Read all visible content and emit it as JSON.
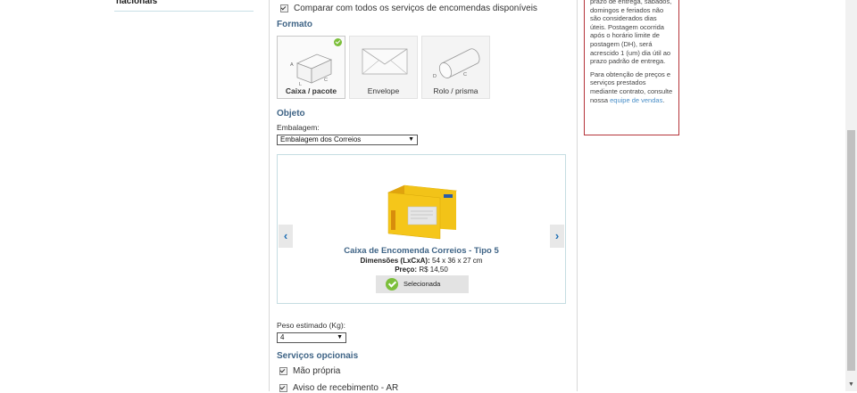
{
  "sidebar": {
    "partial_link": "nacionais"
  },
  "form": {
    "compare_label": "Comparar com todos os serviços de encomendas disponíveis",
    "formato": {
      "title": "Formato",
      "options": [
        {
          "label": "Caixa / pacote",
          "selected": true,
          "icon": "box-icon",
          "dims": [
            "A",
            "L",
            "C"
          ]
        },
        {
          "label": "Envelope",
          "selected": false,
          "icon": "envelope-icon"
        },
        {
          "label": "Rolo / prisma",
          "selected": false,
          "icon": "cylinder-icon",
          "dims": [
            "D",
            "C"
          ]
        }
      ]
    },
    "objeto": {
      "title": "Objeto",
      "embalagem_label": "Embalagem:",
      "embalagem_value": "Embalagem dos Correios"
    },
    "product": {
      "name": "Caixa de Encomenda Correios - Tipo 5",
      "dims_label": "Dimensões (LxCxA):",
      "dims_value": "54 x 36 x 27 cm",
      "price_label": "Preço:",
      "price_value": "R$ 14,50",
      "selected_label": "Selecionada",
      "prev": "‹",
      "next": "›",
      "brand_color": "#f2c318"
    },
    "peso": {
      "label": "Peso estimado (Kg):",
      "value": "4"
    },
    "servicos": {
      "title": "Serviços opcionais",
      "items": [
        "Mão própria",
        "Aviso de recebimento - AR"
      ]
    }
  },
  "info_box": {
    "paragraph1": "prazo de entrega, sábados, domingos e feriados não são considerados dias úteis. Postagem ocorrida após o horário limite de postagem (DH), será acrescido 1 (um) dia útil ao prazo padrão de entrega.",
    "paragraph2_text": "Para obtenção de preços e serviços prestados mediante contrato, consulte nossa",
    "paragraph2_link": "equipe de vendas",
    "paragraph2_end": "."
  },
  "colors": {
    "accent": "#3f6486",
    "check_green": "#7cbf3b",
    "box_border": "#b5343a"
  }
}
